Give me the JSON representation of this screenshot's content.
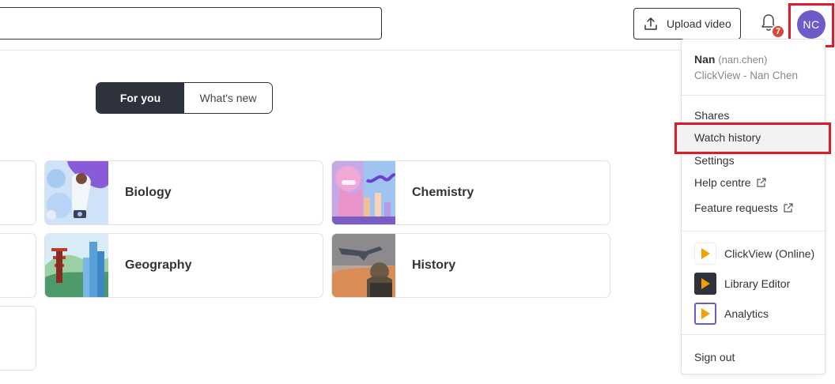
{
  "header": {
    "upload_label": "Upload video",
    "notification_count": "7",
    "avatar_initials": "NC"
  },
  "tabs": [
    {
      "label": "For you",
      "active": true
    },
    {
      "label": "What's new",
      "active": false
    }
  ],
  "subjects": [
    "Biology",
    "Chemistry",
    "Geography",
    "History"
  ],
  "user_menu": {
    "user_name": "Nan",
    "user_handle": "(nan.chen)",
    "user_org": "ClickView - Nan Chen",
    "items": [
      "Shares",
      "Watch history",
      "Settings",
      "Help centre",
      "Feature requests"
    ],
    "apps": [
      "ClickView (Online)",
      "Library Editor",
      "Analytics"
    ],
    "sign_out": "Sign out"
  },
  "colors": {
    "accent_orange": "#f5a000",
    "avatar_purple": "#6c5bc9",
    "dark_tab": "#2e323d",
    "highlight_red": "#e0192b",
    "badge_red": "#d34a3a"
  }
}
